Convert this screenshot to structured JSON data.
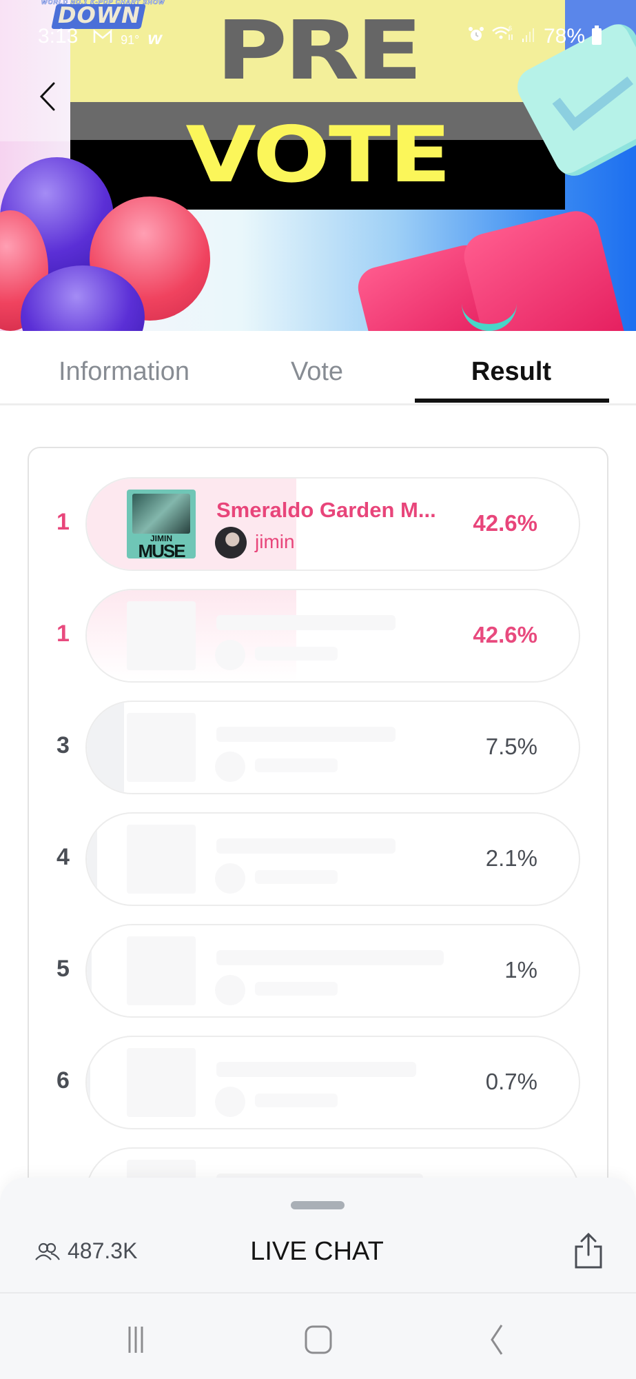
{
  "status_bar": {
    "time": "3:13",
    "left_icons": [
      "gmail-icon",
      "weather-icon",
      "weverse-icon"
    ],
    "temperature": "91°",
    "right_icons": [
      "alarm-icon",
      "wifi-icon",
      "signal-icon"
    ],
    "battery": "78%"
  },
  "banner": {
    "logo_tagline": "WORLD NO.1 K-POP CHART SHOW",
    "logo_text": "DOWN",
    "line1": "PRE",
    "line2": "VOTE",
    "back_icon": "chevron-left-icon"
  },
  "tabs": [
    {
      "label": "Information",
      "active": false
    },
    {
      "label": "Vote",
      "active": false
    },
    {
      "label": "Result",
      "active": true
    }
  ],
  "results": [
    {
      "rank": "1",
      "title": "Smeraldo Garden M...",
      "artist": "jimin",
      "album_art_line1": "JIMIN",
      "album_art_line2": "MUSE",
      "percent_label": "42.6%",
      "percent": 42.6,
      "highlight": true,
      "faded": false
    },
    {
      "rank": "1",
      "title": "",
      "artist": "",
      "percent_label": "42.6%",
      "percent": 42.6,
      "highlight": true,
      "faded": true
    },
    {
      "rank": "3",
      "title": "",
      "artist": "",
      "percent_label": "7.5%",
      "percent": 7.5,
      "highlight": false,
      "faded": true
    },
    {
      "rank": "4",
      "title": "",
      "artist": "",
      "percent_label": "2.1%",
      "percent": 2.1,
      "highlight": false,
      "faded": true
    },
    {
      "rank": "5",
      "title": "",
      "artist": "",
      "percent_label": "1%",
      "percent": 1,
      "highlight": false,
      "faded": true
    },
    {
      "rank": "6",
      "title": "",
      "artist": "",
      "percent_label": "0.7%",
      "percent": 0.7,
      "highlight": false,
      "faded": true
    },
    {
      "rank": "",
      "title": "",
      "artist": "",
      "percent_label": "",
      "percent": 0,
      "highlight": false,
      "faded": true
    }
  ],
  "bottom_sheet": {
    "viewers": "487.3K",
    "live_chat_label": "LIVE CHAT",
    "share_icon": "share-icon"
  },
  "colors": {
    "accent": "#e8457a",
    "fill": "#fde8ef",
    "rank_default": "#4a4e55",
    "tab_active": "#111111",
    "tab_inactive": "#878c93"
  }
}
